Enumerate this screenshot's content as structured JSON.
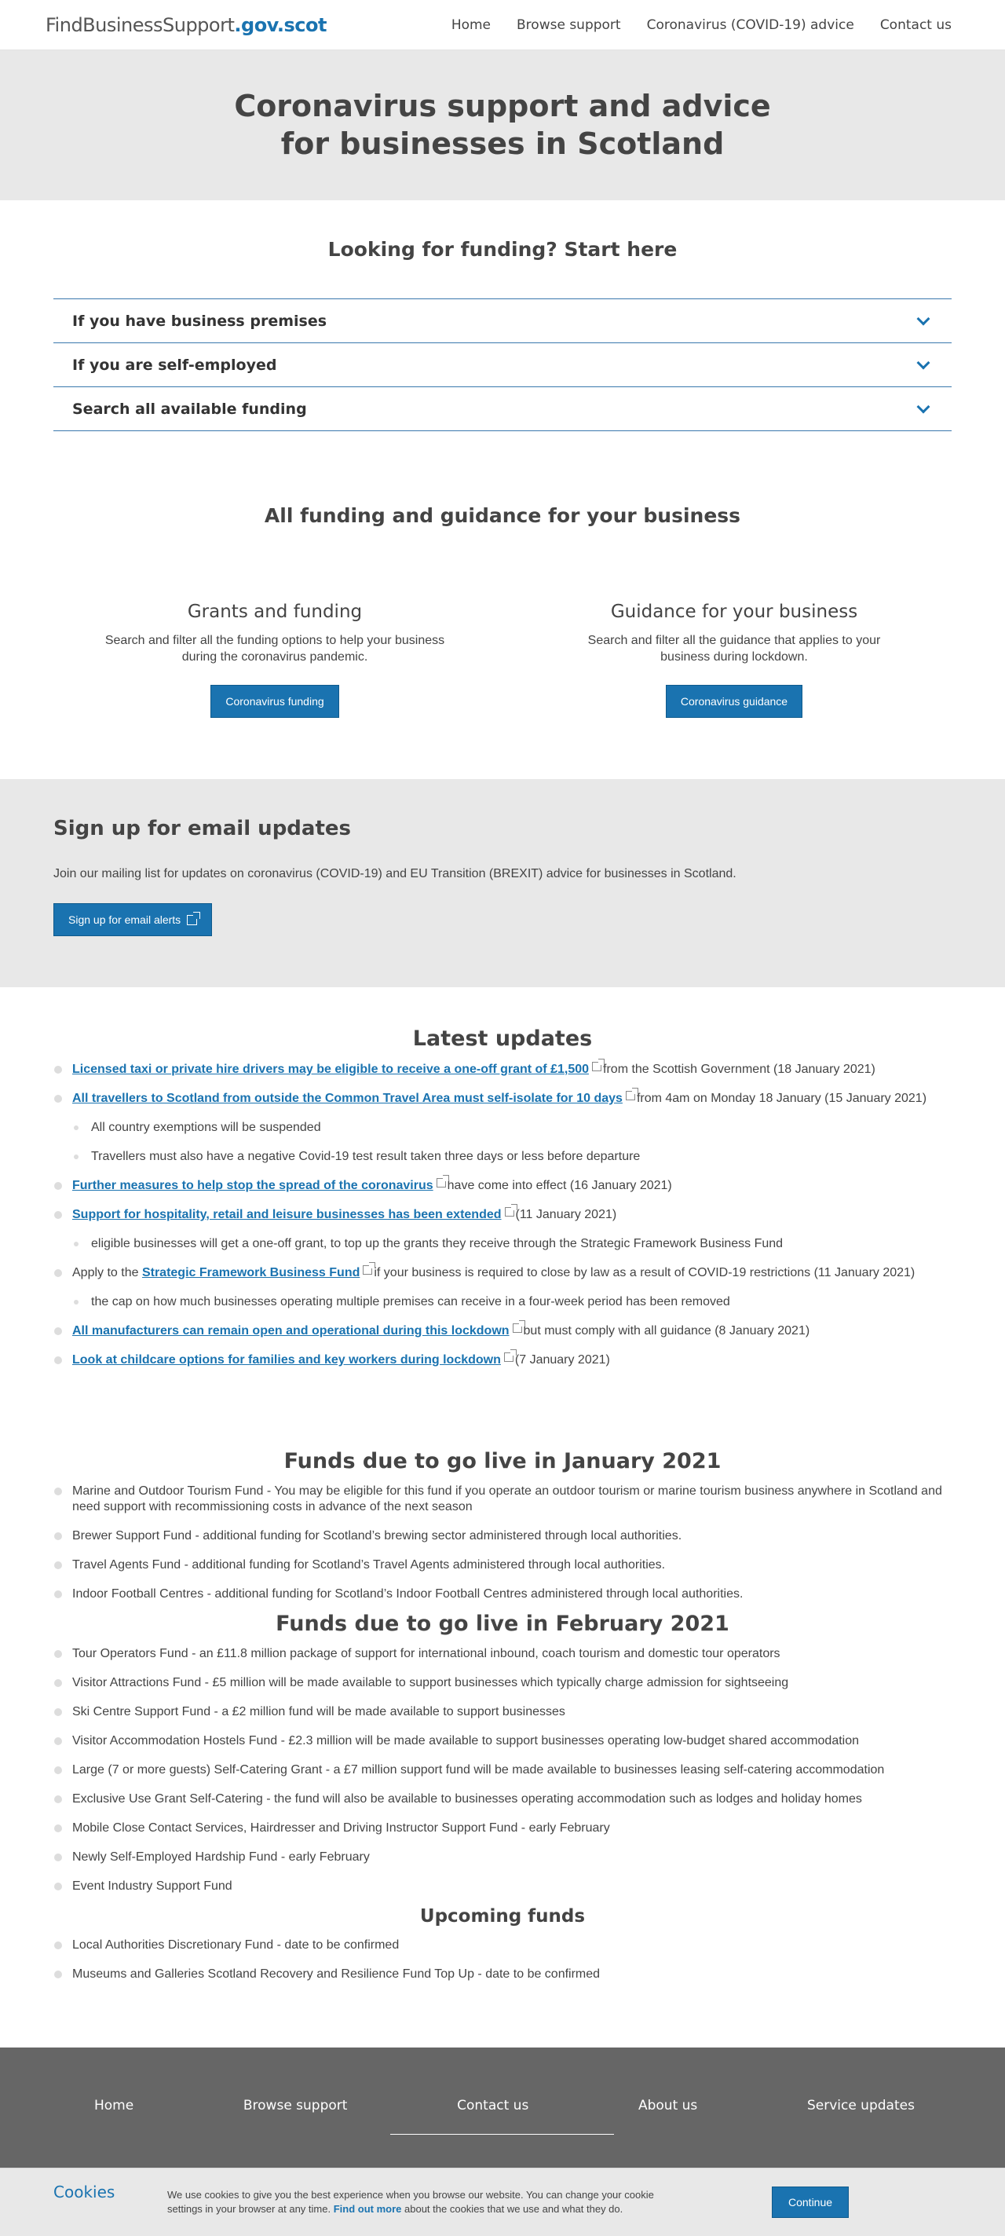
{
  "header": {
    "logo_main": "FindBusinessSupport",
    "logo_domain": ".gov.scot",
    "nav": [
      "Home",
      "Browse support",
      "Coronavirus (COVID-19) advice",
      "Contact us"
    ]
  },
  "hero": {
    "title": "Coronavirus support and advice for businesses in Scotland"
  },
  "funding": {
    "heading": "Looking for funding? Start here",
    "accordion": [
      "If you have business premises",
      "If you are self-employed",
      "Search all available funding"
    ]
  },
  "all_funding": {
    "heading": "All funding and guidance for your business",
    "cards": [
      {
        "title": "Grants and funding",
        "text": "Search and filter all the funding options to help your business during the coronavirus pandemic.",
        "button": "Coronavirus funding"
      },
      {
        "title": "Guidance for your business",
        "text": "Search and filter all the guidance that applies to your business during lockdown.",
        "button": "Coronavirus guidance"
      }
    ]
  },
  "signup": {
    "heading": "Sign up for email updates",
    "text": "Join our mailing list for updates on coronavirus (COVID-19) and EU Transition (BREXIT) advice for businesses in Scotland.",
    "button": "Sign up for email alerts"
  },
  "updates": {
    "heading": "Latest updates",
    "items": [
      {
        "pre": "",
        "link": "Licensed taxi or private hire drivers may be eligible to receive a one-off grant of £1,500",
        "post": "from the Scottish Government (18 January 2021)",
        "sub": false
      },
      {
        "pre": "",
        "link": "All travellers to Scotland from outside the Common Travel Area must self-isolate for 10 days",
        "post": "from 4am on Monday 18 January (15 January 2021)",
        "sub": false
      },
      {
        "pre": "All country exemptions will be suspended",
        "link": "",
        "post": "",
        "sub": true
      },
      {
        "pre": "Travellers must also have a negative Covid-19 test result taken three days or less before departure",
        "link": "",
        "post": "",
        "sub": true
      },
      {
        "pre": "",
        "link": "Further measures to help stop the spread of the coronavirus",
        "post": "have come into effect (16 January 2021)",
        "sub": false
      },
      {
        "pre": "",
        "link": "Support for hospitality, retail and leisure businesses has been extended",
        "post": "(11 January 2021)",
        "sub": false
      },
      {
        "pre": "eligible businesses will get a one-off grant, to top up the grants they receive through the Strategic Framework Business Fund",
        "link": "",
        "post": "",
        "sub": true
      },
      {
        "pre": "Apply to the",
        "link": "Strategic Framework Business Fund",
        "post": "if your business is required to close by law as a result of COVID-19 restrictions (11 January 2021)",
        "sub": false
      },
      {
        "pre": "the cap on how much businesses operating multiple premises can receive in a four-week period has been removed",
        "link": "",
        "post": "",
        "sub": true
      },
      {
        "pre": "",
        "link": "All manufacturers can remain open and operational during this lockdown",
        "post": "but must comply with all guidance (8 January 2021)",
        "sub": false
      },
      {
        "pre": "",
        "link": "Look at childcare options for families and key workers during lockdown",
        "post": "(7 January 2021)",
        "sub": false
      }
    ]
  },
  "jan_funds": {
    "heading": "Funds due to go live in January 2021",
    "items": [
      "Marine and Outdoor Tourism Fund - You may be eligible for this fund if you operate an outdoor tourism or marine tourism business anywhere in Scotland and need support with recommissioning costs in advance of the next season",
      "Brewer Support Fund - additional funding for Scotland’s brewing sector administered through local authorities.",
      "Travel Agents Fund - additional funding for Scotland’s Travel Agents administered through local authorities.",
      "Indoor Football Centres - additional funding for Scotland’s Indoor Football Centres administered through local authorities."
    ]
  },
  "feb_funds": {
    "heading": "Funds due to go live in February 2021",
    "items": [
      "Tour Operators Fund - an £11.8 million package of support for international inbound, coach tourism and domestic tour operators",
      "Visitor Attractions Fund - £5 million will be made available to support businesses which typically charge admission for sightseeing",
      "Ski Centre Support Fund - a £2 million fund will be made available to support businesses",
      "Visitor Accommodation Hostels Fund - £2.3 million will be made available to support businesses operating low-budget shared accommodation",
      "Large (7 or more guests) Self-Catering Grant - a £7 million support fund will be made available to businesses leasing self-catering accommodation",
      "Exclusive Use Grant Self-Catering - the fund will also be available to businesses operating accommodation such as lodges and holiday homes",
      "Mobile Close Contact Services, Hairdresser and Driving Instructor Support Fund - early February",
      "Newly Self-Employed Hardship Fund - early February",
      "Event Industry Support Fund"
    ]
  },
  "upcoming": {
    "heading": "Upcoming funds",
    "items": [
      "Local Authorities Discretionary Fund - date to be confirmed",
      "Museums and Galleries Scotland Recovery and Resilience Fund Top Up - date to be confirmed"
    ]
  },
  "footer": {
    "nav": [
      "Home",
      "Browse support",
      "Contact us",
      "About us",
      "Service updates"
    ]
  },
  "cookie": {
    "heading": "Cookies",
    "text_before": "We use cookies to give you the best experience when you browse our website. You can change your cookie settings in your browser at any time.",
    "link": "Find out more",
    "text_after": "about the cookies that we use and what they do.",
    "button": "Continue"
  }
}
